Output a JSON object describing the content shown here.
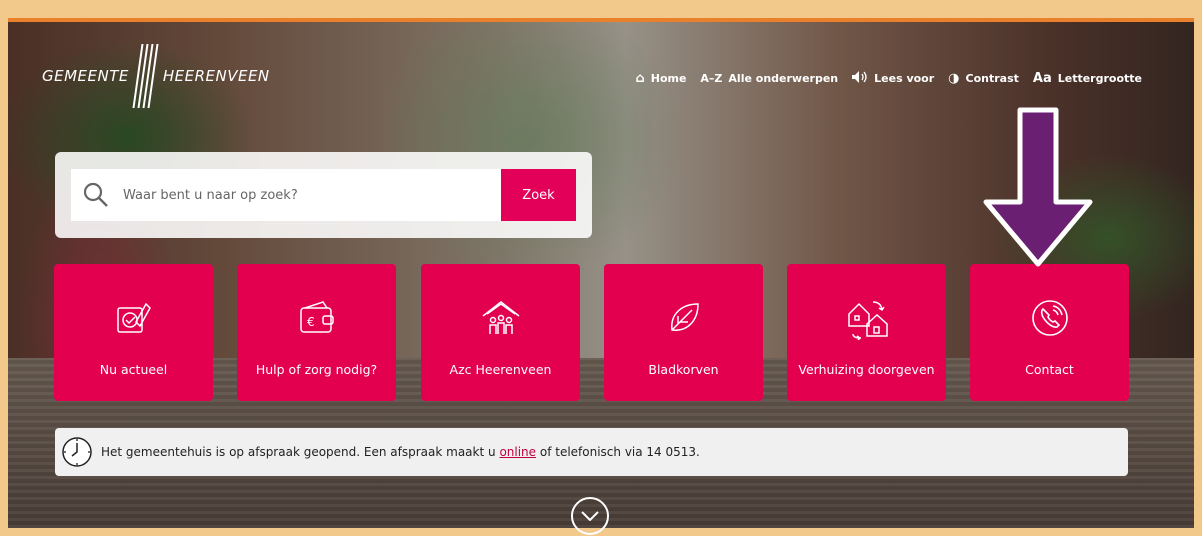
{
  "logo": {
    "left": "GEMEENTE",
    "right": "HEERENVEEN"
  },
  "topnav": [
    {
      "icon": "home-icon",
      "glyph": "⌂",
      "label": "Home"
    },
    {
      "icon": "az-icon",
      "glyph": "A–Z",
      "label": "Alle onderwerpen"
    },
    {
      "icon": "speaker-icon",
      "glyph": "🔊",
      "label": "Lees voor"
    },
    {
      "icon": "contrast-icon",
      "glyph": "◑",
      "label": "Contrast"
    },
    {
      "icon": "font-size-icon",
      "glyph": "Aa",
      "label": "Lettergrootte"
    }
  ],
  "search": {
    "placeholder": "Waar bent u naar op zoek?",
    "button": "Zoek"
  },
  "tiles": [
    {
      "label": "Nu actueel",
      "icon": "news-icon"
    },
    {
      "label": "Hulp of zorg nodig?",
      "icon": "wallet-euro-icon"
    },
    {
      "label": "Azc Heerenveen",
      "icon": "family-house-icon"
    },
    {
      "label": "Bladkorven",
      "icon": "leaf-icon"
    },
    {
      "label": "Verhuizing doorgeven",
      "icon": "moving-houses-icon"
    },
    {
      "label": "Contact",
      "icon": "phone-icon"
    }
  ],
  "notice": {
    "before": "Het gemeentehuis is op afspraak geopend. Een afspraak maakt u ",
    "link": "online",
    "after": " of telefonisch via 14 0513."
  },
  "colors": {
    "accent": "#e2004f",
    "frame": "#f3c98b",
    "arrow": "#6b1f73"
  }
}
